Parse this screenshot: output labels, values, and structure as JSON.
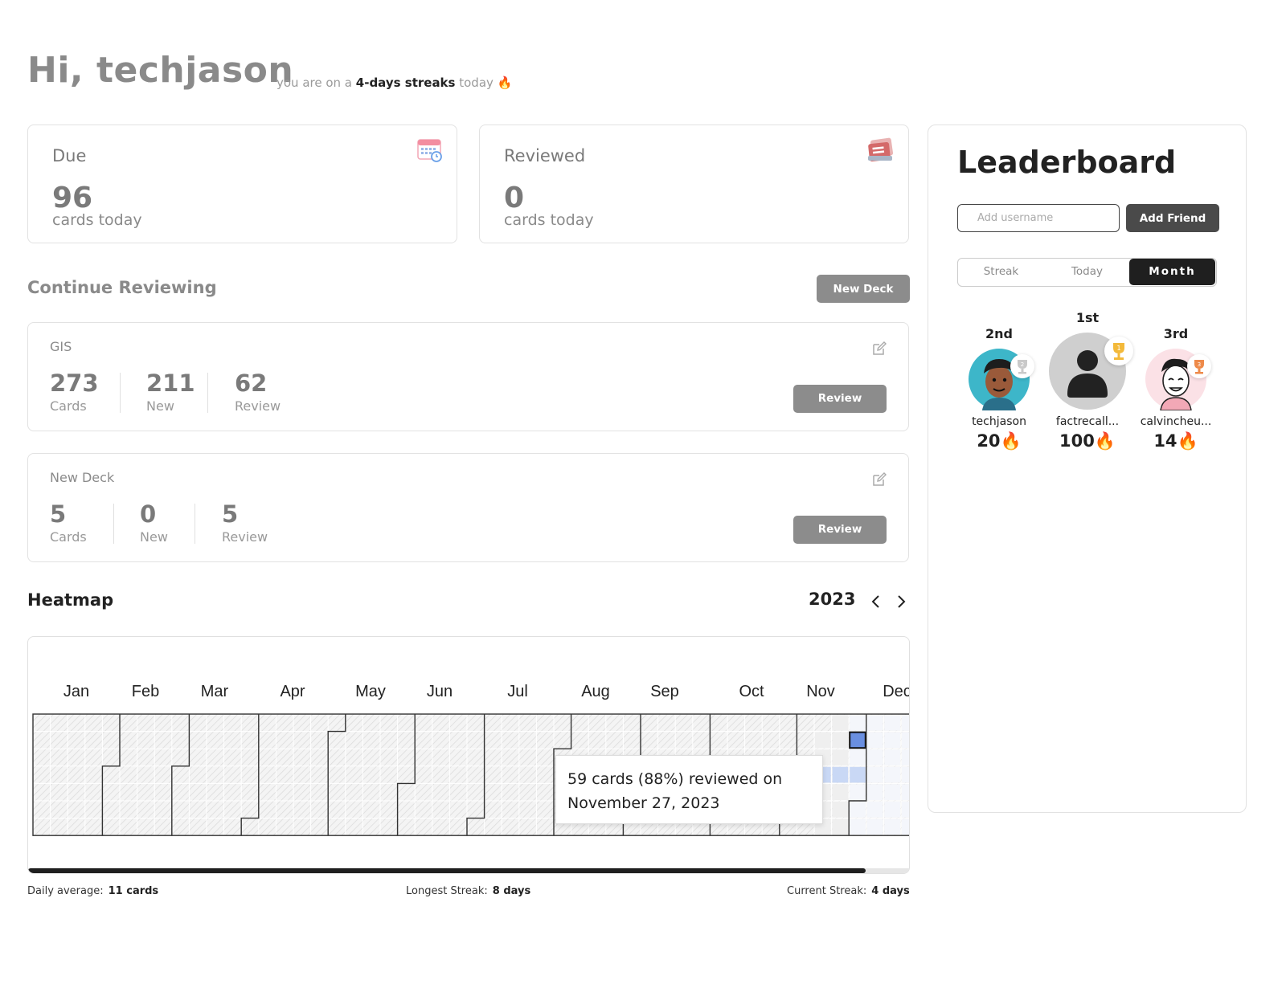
{
  "greeting": "Hi, techjason",
  "streak_line": {
    "prefix": "you are on a",
    "highlight": "4-days streaks",
    "suffix": "today",
    "emoji": "🔥"
  },
  "stats": [
    {
      "label": "Due",
      "value": "96",
      "sub": "cards today",
      "icon": "calendar-icon"
    },
    {
      "label": "Reviewed",
      "value": "0",
      "sub": "cards today",
      "icon": "cards-stack-icon"
    }
  ],
  "continue": {
    "title": "Continue Reviewing",
    "new_deck_label": "New Deck"
  },
  "decks": [
    {
      "name": "GIS",
      "cards": "273",
      "cards_label": "Cards",
      "new": "211",
      "new_label": "New",
      "review": "62",
      "review_label": "Review",
      "button": "Review"
    },
    {
      "name": "New Deck",
      "cards": "5",
      "cards_label": "Cards",
      "new": "0",
      "new_label": "New",
      "review": "5",
      "review_label": "Review",
      "button": "Review"
    }
  ],
  "heatmap": {
    "title": "Heatmap",
    "year": "2023",
    "months": [
      "Jan",
      "Feb",
      "Mar",
      "Apr",
      "May",
      "Jun",
      "Jul",
      "Aug",
      "Sep",
      "Oct",
      "Nov",
      "Dec"
    ],
    "tooltip_line1": "59 cards (88%) reviewed on",
    "tooltip_line2": "November 27, 2023",
    "colors": {
      "selected": "#6a8fe0",
      "light": "#c9d8f5",
      "empty": "#efefef"
    }
  },
  "footer": {
    "daily_avg_label": "Daily average:",
    "daily_avg_value": "11 cards",
    "longest_label": "Longest Streak:",
    "longest_value": "8 days",
    "current_label": "Current Streak:",
    "current_value": "4 days"
  },
  "leaderboard": {
    "title": "Leaderboard",
    "input_placeholder": "Add username",
    "add_button": "Add Friend",
    "tabs": [
      "Streak",
      "Today",
      "Month"
    ],
    "active_tab": "Month",
    "podium": [
      {
        "rank": "2nd",
        "name": "techjason",
        "score": "20🔥"
      },
      {
        "rank": "1st",
        "name": "factrecall...",
        "score": "100🔥"
      },
      {
        "rank": "3rd",
        "name": "calvincheu...",
        "score": "14🔥"
      }
    ]
  }
}
